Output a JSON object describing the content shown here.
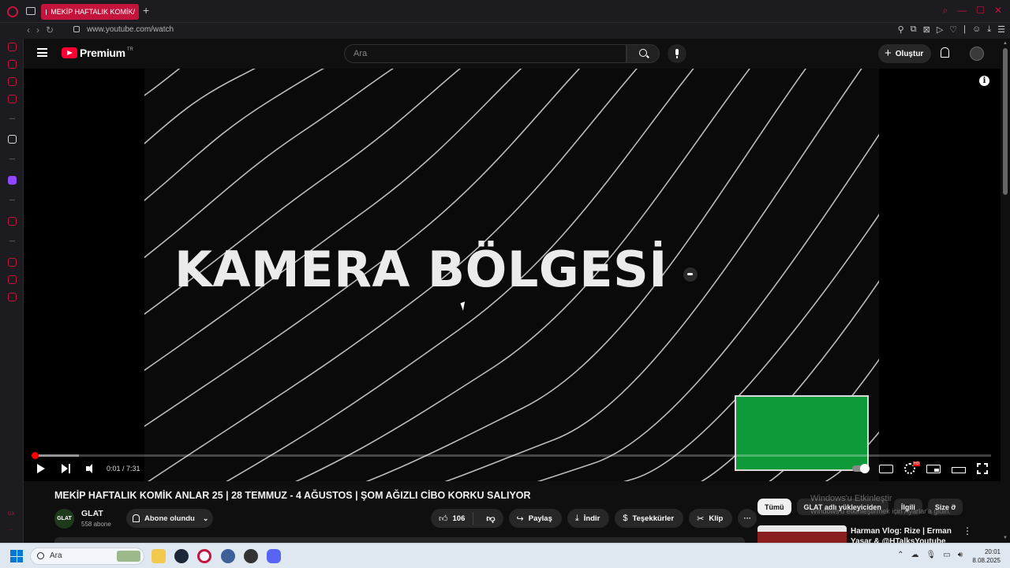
{
  "browser": {
    "tab_title": "MEKİP HAFTALIK KOMİK",
    "url": "www.youtube.com/watch",
    "new_tab_symbol": "+",
    "tab_close_symbol": "/"
  },
  "header": {
    "logo_text": "Premium",
    "region": "TR",
    "search_placeholder": "Ara",
    "create_label": "Oluştur",
    "create_symbol": "+"
  },
  "player": {
    "overlay_text": "KAMERA BÖLGESİ",
    "time": "0:01 / 7:31",
    "progress_fraction": 0.002,
    "loaded_fraction": 0.048,
    "info_symbol": "i",
    "hd_badge": "HD"
  },
  "video": {
    "title": "MEKİP HAFTALIK KOMİK ANLAR 25 | 28 TEMMUZ - 4 AĞUSTOS | ŞOM AĞIZLI CİBO KORKU SALIYOR",
    "channel_name": "GLAT",
    "channel_avatar_text": "GLAT",
    "subscribers": "558 abone",
    "subscribe_label": "Abone olundu",
    "chevron": "⌄",
    "likes": "106",
    "share_label": "Paylaş",
    "download_label": "İndir",
    "thanks_label": "Teşekkürler",
    "clip_label": "Klip",
    "more_symbol": "···"
  },
  "related": {
    "chips": [
      "Tümü",
      "GLAT adlı yükleyiciden",
      "İlgili",
      "Size ö"
    ],
    "next_symbol": "›",
    "first_title_line1": "Harman Vlog: Rize | Erman",
    "first_title_line2": "Yaşar & @HTalksYoutube",
    "more_symbol": "⋮"
  },
  "windows": {
    "watermark_title": "Windows'u Etkinleştir",
    "watermark_sub": "Windows'u etkinleştirmek için Ayarlar'a gidin.",
    "search_placeholder": "Ara",
    "time": "20:01",
    "date": "8.08.2025"
  },
  "icons": {
    "window_controls": [
      "search-icon",
      "minimize-icon",
      "maximize-icon",
      "close-icon"
    ],
    "address_tools": [
      "pin-icon",
      "snapshot-icon",
      "vpn-icon",
      "player-icon",
      "heart-icon",
      "divider",
      "profile-icon",
      "download-icon",
      "menu-icon"
    ]
  },
  "colors": {
    "accent": "#c4143c",
    "youtube_red": "#ff0033",
    "green_screen": "#0f9a3a"
  }
}
